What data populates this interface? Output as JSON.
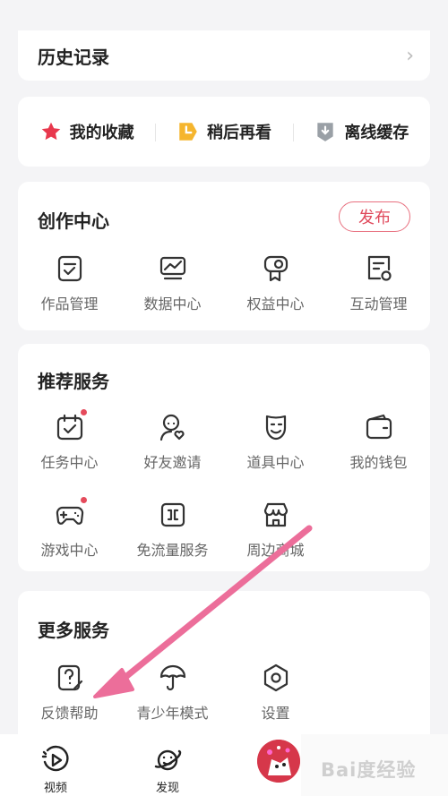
{
  "history": {
    "title": "历史记录"
  },
  "quick": [
    {
      "label": "我的收藏",
      "icon": "star-icon"
    },
    {
      "label": "稍后再看",
      "icon": "clock-icon"
    },
    {
      "label": "离线缓存",
      "icon": "download-icon"
    }
  ],
  "create": {
    "title": "创作中心",
    "publish": "发布",
    "items": [
      "作品管理",
      "数据中心",
      "权益中心",
      "互动管理"
    ]
  },
  "recommend": {
    "title": "推荐服务",
    "items": [
      "任务中心",
      "好友邀请",
      "道具中心",
      "我的钱包",
      "游戏中心",
      "免流量服务",
      "周边商城"
    ]
  },
  "more": {
    "title": "更多服务",
    "items": [
      "反馈帮助",
      "青少年模式",
      "设置"
    ]
  },
  "tabs": [
    {
      "label": "视频",
      "icon": "video-icon"
    },
    {
      "label": "发现",
      "icon": "planet-icon"
    }
  ],
  "watermark": {
    "text": "Bai度经验"
  },
  "colors": {
    "accent": "#e04a5c",
    "star": "#e8384d",
    "clock": "#f5b52e",
    "arrow": "#ec6e9a"
  }
}
